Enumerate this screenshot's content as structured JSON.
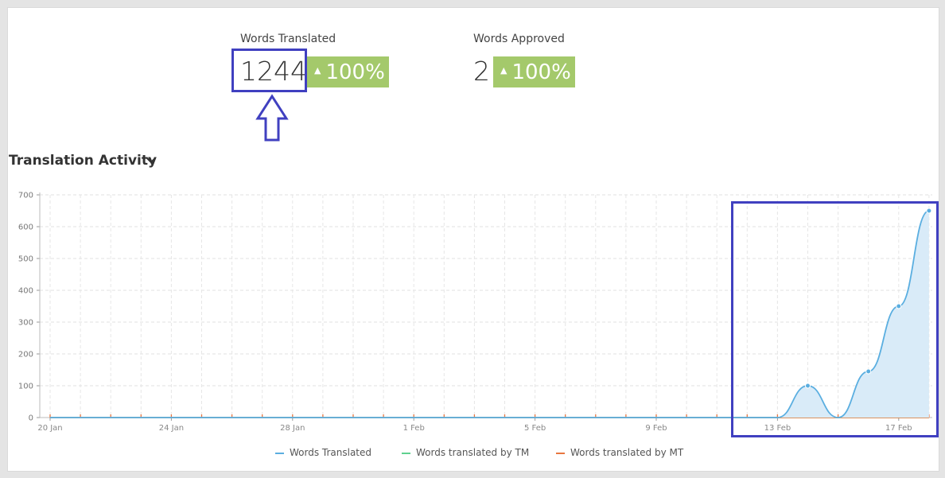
{
  "stats": [
    {
      "label": "Words Translated",
      "value": "1244",
      "change": "100%"
    },
    {
      "label": "Words Approved",
      "value": "2",
      "change": "100%"
    }
  ],
  "section": {
    "title": "Translation Activity"
  },
  "colors": {
    "translated": "#5aaee0",
    "tm": "#5fd18f",
    "mt": "#e8763f",
    "badge": "#a4c96b",
    "highlight": "#4040c0"
  },
  "chart_data": {
    "type": "area",
    "x_tick_labels": [
      "20 Jan",
      "24 Jan",
      "28 Jan",
      "1 Feb",
      "5 Feb",
      "9 Feb",
      "13 Feb",
      "17 Feb"
    ],
    "ylim": [
      0,
      700
    ],
    "y_ticks": [
      0,
      100,
      200,
      300,
      400,
      500,
      600,
      700
    ],
    "grid": true,
    "x": [
      "20 Jan",
      "21 Jan",
      "22 Jan",
      "23 Jan",
      "24 Jan",
      "25 Jan",
      "26 Jan",
      "27 Jan",
      "28 Jan",
      "29 Jan",
      "30 Jan",
      "31 Jan",
      "1 Feb",
      "2 Feb",
      "3 Feb",
      "4 Feb",
      "5 Feb",
      "6 Feb",
      "7 Feb",
      "8 Feb",
      "9 Feb",
      "10 Feb",
      "11 Feb",
      "12 Feb",
      "13 Feb",
      "14 Feb",
      "15 Feb",
      "16 Feb",
      "17 Feb",
      "18 Feb"
    ],
    "series": [
      {
        "name": "Words Translated",
        "values": [
          0,
          0,
          0,
          0,
          0,
          0,
          0,
          0,
          0,
          0,
          0,
          0,
          0,
          0,
          0,
          0,
          0,
          0,
          0,
          0,
          0,
          0,
          0,
          0,
          0,
          100,
          0,
          145,
          350,
          650
        ]
      },
      {
        "name": "Words translated by TM",
        "values": [
          0,
          0,
          0,
          0,
          0,
          0,
          0,
          0,
          0,
          0,
          0,
          0,
          0,
          0,
          0,
          0,
          0,
          0,
          0,
          0,
          0,
          0,
          0,
          0,
          0,
          0,
          0,
          0,
          0,
          0
        ]
      },
      {
        "name": "Words translated by MT",
        "values": [
          0,
          0,
          0,
          0,
          0,
          0,
          0,
          0,
          0,
          0,
          0,
          0,
          0,
          0,
          0,
          0,
          0,
          0,
          0,
          0,
          0,
          0,
          0,
          0,
          0,
          0,
          0,
          0,
          0,
          0
        ]
      }
    ],
    "legend_position": "bottom"
  }
}
